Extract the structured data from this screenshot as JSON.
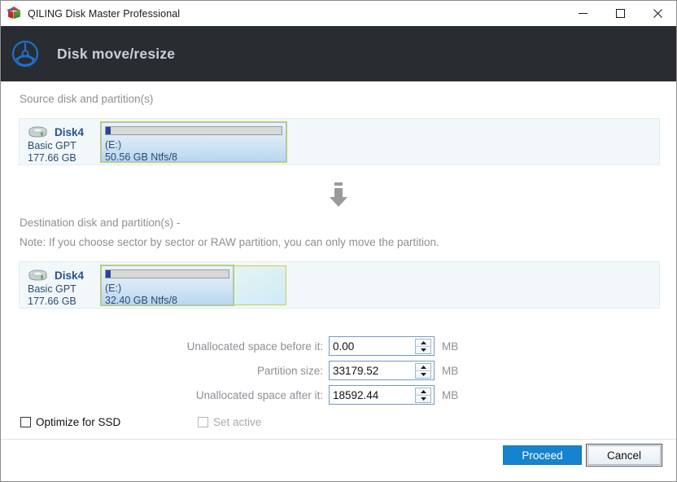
{
  "window": {
    "title": "QILING Disk Master Professional",
    "app_icon": "cube-icon",
    "controls": {
      "minimize": "minimize-icon",
      "maximize": "maximize-icon",
      "close": "close-icon"
    }
  },
  "header": {
    "logo": "qiling-wheel-logo-icon",
    "title": "Disk move/resize"
  },
  "source": {
    "label": "Source disk and partition(s)",
    "disk": {
      "icon": "hard-disk-icon",
      "name": "Disk4",
      "type": "Basic GPT",
      "capacity": "177.66 GB"
    },
    "partition": {
      "drive_letter": "(E:)",
      "size_fs": "50.56 GB Ntfs/8",
      "used_percent": 3
    }
  },
  "transfer_arrow_icon": "down-arrow-icon",
  "destination": {
    "label": "Destination disk and partition(s) -",
    "note": "Note: If you choose sector by sector or RAW partition, you can only move the partition.",
    "disk": {
      "icon": "hard-disk-icon",
      "name": "Disk4",
      "type": "Basic GPT",
      "capacity": "177.66 GB"
    },
    "partition": {
      "drive_letter": "(E:)",
      "size_fs": "32.40 GB Ntfs/8",
      "used_percent": 4
    },
    "unallocated_label": ""
  },
  "fields": [
    {
      "label": "Unallocated space before it:",
      "value": "0.00",
      "unit": "MB"
    },
    {
      "label": "Partition size:",
      "value": "33179.52",
      "unit": "MB"
    },
    {
      "label": "Unallocated space after it:",
      "value": "18592.44",
      "unit": "MB"
    }
  ],
  "options": {
    "optimize_ssd": {
      "label": "Optimize for SSD",
      "checked": false,
      "disabled": false
    },
    "set_active": {
      "label": "Set active",
      "checked": false,
      "disabled": true
    }
  },
  "footer": {
    "proceed_label": "Proceed",
    "cancel_label": "Cancel"
  },
  "colors": {
    "accent": "#1683ce",
    "header_bg": "#292d32",
    "logo_blue": "#1f6fd0",
    "muted_text": "#8b9096",
    "disk_text": "#28528f"
  }
}
